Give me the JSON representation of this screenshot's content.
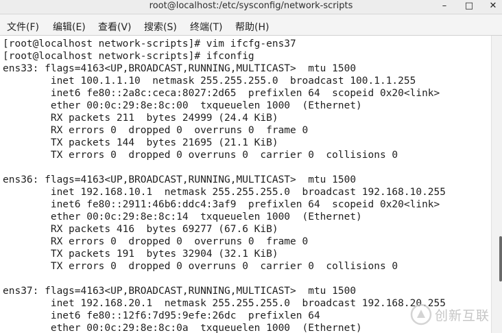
{
  "window": {
    "title": "root@localhost:/etc/sysconfig/network-scripts",
    "minimize_glyph": "–",
    "maximize_glyph": "□",
    "close_glyph": "✕"
  },
  "menu": [
    {
      "label": "文件(F)"
    },
    {
      "label": "编辑(E)"
    },
    {
      "label": "查看(V)"
    },
    {
      "label": "搜索(S)"
    },
    {
      "label": "终端(T)"
    },
    {
      "label": "帮助(H)"
    }
  ],
  "terminal": {
    "lines": [
      "[root@localhost network-scripts]# vim ifcfg-ens37",
      "[root@localhost network-scripts]# ifconfig",
      "ens33: flags=4163<UP,BROADCAST,RUNNING,MULTICAST>  mtu 1500",
      "        inet 100.1.1.10  netmask 255.255.255.0  broadcast 100.1.1.255",
      "        inet6 fe80::2a8c:ceca:8027:2d65  prefixlen 64  scopeid 0x20<link>",
      "        ether 00:0c:29:8e:8c:00  txqueuelen 1000  (Ethernet)",
      "        RX packets 211  bytes 24999 (24.4 KiB)",
      "        RX errors 0  dropped 0  overruns 0  frame 0",
      "        TX packets 144  bytes 21695 (21.1 KiB)",
      "        TX errors 0  dropped 0 overruns 0  carrier 0  collisions 0",
      "",
      "ens36: flags=4163<UP,BROADCAST,RUNNING,MULTICAST>  mtu 1500",
      "        inet 192.168.10.1  netmask 255.255.255.0  broadcast 192.168.10.255",
      "        inet6 fe80::2911:46b6:ddc4:3af9  prefixlen 64  scopeid 0x20<link>",
      "        ether 00:0c:29:8e:8c:14  txqueuelen 1000  (Ethernet)",
      "        RX packets 416  bytes 69277 (67.6 KiB)",
      "        RX errors 0  dropped 0  overruns 0  frame 0",
      "        TX packets 191  bytes 32904 (32.1 KiB)",
      "        TX errors 0  dropped 0 overruns 0  carrier 0  collisions 0",
      "",
      "ens37: flags=4163<UP,BROADCAST,RUNNING,MULTICAST>  mtu 1500",
      "        inet 192.168.20.1  netmask 255.255.255.0  broadcast 192.168.20.255",
      "        inet6 fe80::12f6:7d95:9efe:26dc  prefixlen 64",
      "        ether 00:0c:29:8e:8c:0a  txqueuelen 1000  (Ethernet)"
    ]
  },
  "watermark": {
    "text": "创新互联",
    "logo_icon": "watermark-logo-icon"
  },
  "colors": {
    "terminal_bg": "#ffffff",
    "terminal_fg": "#1e1e1e",
    "menubar_bg": "#f4f4f4",
    "titlebar_bg": "#ededed"
  }
}
